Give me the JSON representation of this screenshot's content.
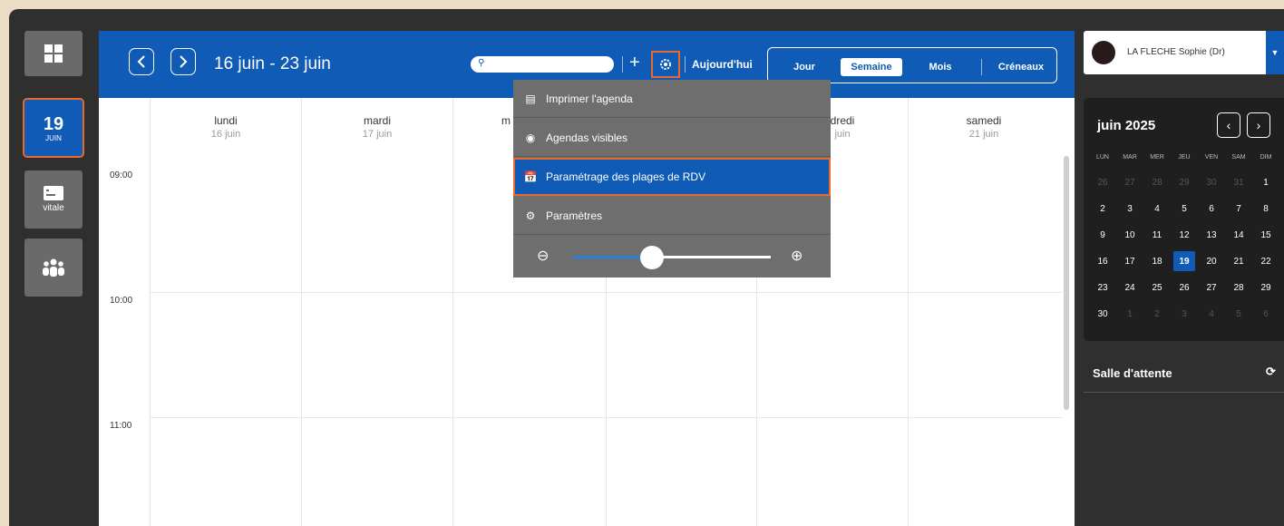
{
  "sidebar": {
    "today_day": "19",
    "today_month": "JUIN",
    "vitale_label": "vitale"
  },
  "header": {
    "range": "16 juin - 23 juin",
    "today_label": "Aujourd'hui",
    "views": [
      {
        "label": "Jour",
        "active": false
      },
      {
        "label": "Semaine",
        "active": true
      },
      {
        "label": "Mois",
        "active": false
      },
      {
        "label": "Créneaux",
        "active": false
      }
    ]
  },
  "days": [
    {
      "name": "lundi",
      "date": "16 juin"
    },
    {
      "name": "mardi",
      "date": "17 juin"
    },
    {
      "name": "m",
      "date": ""
    },
    {
      "name": "",
      "date": ""
    },
    {
      "name": "dredi",
      "date": "juin"
    },
    {
      "name": "samedi",
      "date": "21 juin"
    }
  ],
  "times": [
    "09:00",
    "10:00",
    "11:00"
  ],
  "menu": {
    "items": [
      {
        "label": "Imprimer l'agenda",
        "icon": "printer-icon"
      },
      {
        "label": "Agendas visibles",
        "icon": "eye-icon"
      },
      {
        "label": "Paramétrage des plages de RDV",
        "icon": "calendar-settings-icon",
        "active": true
      },
      {
        "label": "Paramètres",
        "icon": "gear-icon"
      }
    ],
    "zoom_level": 0.4
  },
  "doctor": {
    "name": "LA FLECHE Sophie (Dr)"
  },
  "calendar": {
    "title": "juin 2025",
    "weekdays": [
      "LUN",
      "MAR",
      "MER",
      "JEU",
      "VEN",
      "SAM",
      "DIM"
    ],
    "weeks": [
      [
        "26",
        "27",
        "28",
        "29",
        "30",
        "31",
        "1"
      ],
      [
        "2",
        "3",
        "4",
        "5",
        "6",
        "7",
        "8"
      ],
      [
        "9",
        "10",
        "11",
        "12",
        "13",
        "14",
        "15"
      ],
      [
        "16",
        "17",
        "18",
        "19",
        "20",
        "21",
        "22"
      ],
      [
        "23",
        "24",
        "25",
        "26",
        "27",
        "28",
        "29"
      ],
      [
        "30",
        "1",
        "2",
        "3",
        "4",
        "5",
        "6"
      ]
    ],
    "today": "19"
  },
  "waiting_room": {
    "title": "Salle d'attente"
  },
  "colors": {
    "primary": "#0f5bb5",
    "highlight": "#e8692a"
  }
}
